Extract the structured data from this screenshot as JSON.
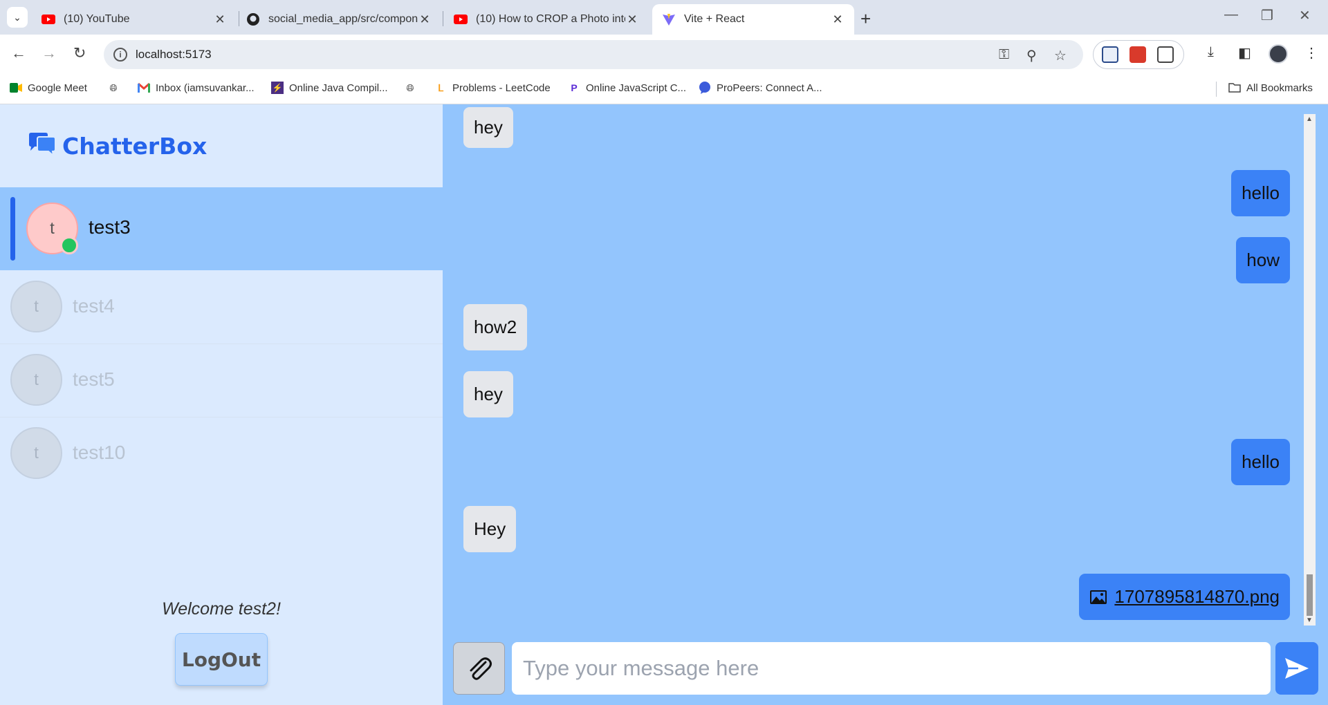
{
  "browser": {
    "tabs": [
      {
        "title": "(10) YouTube",
        "icon": "youtube-icon"
      },
      {
        "title": "social_media_app/src/compone",
        "icon": "github-icon"
      },
      {
        "title": "(10) How to CROP a Photo into",
        "icon": "youtube-icon"
      },
      {
        "title": "Vite + React",
        "icon": "vite-icon",
        "active": true
      }
    ],
    "address": "localhost:5173",
    "bookmarks": [
      {
        "label": "Google Meet",
        "icon": "google-meet-icon"
      },
      {
        "label": "",
        "icon": "globe-icon"
      },
      {
        "label": "Inbox (iamsuvankar...",
        "icon": "gmail-icon"
      },
      {
        "label": "Online Java Compil...",
        "icon": "java-compiler-icon"
      },
      {
        "label": "",
        "icon": "globe-icon"
      },
      {
        "label": "Problems - LeetCode",
        "icon": "leetcode-icon"
      },
      {
        "label": "Online JavaScript C...",
        "icon": "javascript-compiler-icon"
      },
      {
        "label": "ProPeers: Connect A...",
        "icon": "propeers-icon"
      }
    ],
    "all_bookmarks": "All Bookmarks"
  },
  "sidebar": {
    "brand": "ChatterBox",
    "contacts": [
      {
        "initial": "t",
        "name": "test3",
        "active": true,
        "online": true
      },
      {
        "initial": "t",
        "name": "test4",
        "active": false,
        "online": false
      },
      {
        "initial": "t",
        "name": "test5",
        "active": false,
        "online": false
      },
      {
        "initial": "t",
        "name": "test10",
        "active": false,
        "online": false
      }
    ],
    "welcome": "Welcome test2!",
    "logout": "LogOut"
  },
  "chat": {
    "messages": [
      {
        "text": "hey",
        "side": "in"
      },
      {
        "text": "hello",
        "side": "out"
      },
      {
        "text": "how",
        "side": "out"
      },
      {
        "text": "how2",
        "side": "in"
      },
      {
        "text": "hey",
        "side": "in"
      },
      {
        "text": "hello",
        "side": "out"
      },
      {
        "text": "Hey",
        "side": "in"
      },
      {
        "text": "1707895814870.png",
        "side": "out",
        "attachment": true
      }
    ],
    "input_placeholder": "Type your message here"
  },
  "colors": {
    "sidebar_bg": "#dbeafe",
    "active_contact_bg": "#93c5fd",
    "chat_bg": "#93c5fd",
    "outgoing_bubble": "#3b82f6",
    "incoming_bubble": "#e5e7eb",
    "brand": "#2563eb",
    "online": "#22c55e"
  }
}
